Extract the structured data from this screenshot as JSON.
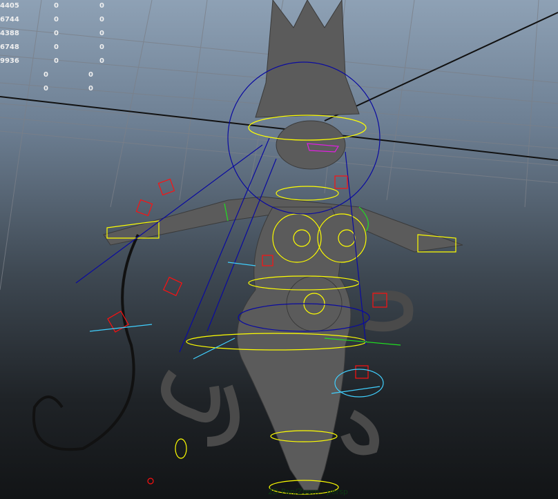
{
  "hud_rows": [
    {
      "a": "4405",
      "b": "0",
      "c": "0"
    },
    {
      "a": "6744",
      "b": "0",
      "c": "0"
    },
    {
      "a": "4388",
      "b": "0",
      "c": "0"
    },
    {
      "a": "6748",
      "b": "0",
      "c": "0"
    },
    {
      "a": "9936",
      "b": "0",
      "c": "0"
    },
    {
      "a": "",
      "b": "0",
      "c": "0"
    },
    {
      "a": "",
      "b": "0",
      "c": "0"
    }
  ],
  "camera_label": "2D Pan/Zoom : persp",
  "colors": {
    "mesh": "#5a5a5a",
    "grid": "#7d8086",
    "ctrl_yellow": "#ffff00",
    "ctrl_red": "#ff1010",
    "ctrl_blue": "#0a0aa0",
    "ctrl_cyan": "#40d0ff",
    "ctrl_green": "#20e020",
    "ctrl_magenta": "#e020e0"
  }
}
